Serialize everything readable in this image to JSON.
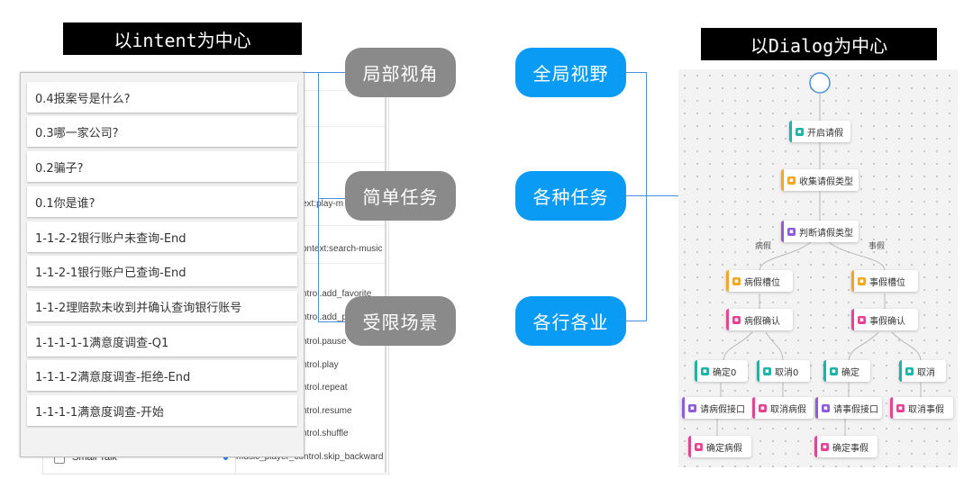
{
  "titles": {
    "left": "以intent为中心",
    "right": "以Dialog为中心"
  },
  "intents": [
    "0.4报案号是什么?",
    "0.3哪一家公司?",
    "0.2骗子?",
    "0.1你是谁?",
    "1-1-2-2银行账户未查询-End",
    "1-1-2-1银行账户已查询-End",
    "1-1-2理赔款未收到并确认查询银行账号",
    "1-1-1-1-1满意度调查-Q1",
    "1-1-1-2满意度调查-拒绝-End",
    "1-1-1-1满意度调查-开始"
  ],
  "background_panel": {
    "right_items": [
      "ext:play-m",
      "ontext:search-music",
      "ntrol.add_favorite",
      "ntrol.add_p",
      "ntrol.pause",
      "ntrol.play",
      "ntrol.repeat",
      "ntrol.resume",
      "ntrol.shuffle"
    ],
    "small_talk": "Small Talk",
    "bottom_item": "music_player_control.skip_backward"
  },
  "bubbles_gray": [
    "局部视角",
    "简单任务",
    "受限场景"
  ],
  "bubbles_blue": [
    "全局视野",
    "各种任务",
    "各行各业"
  ],
  "flow": {
    "nodes": {
      "start": "开启请假",
      "collect": "收集请假类型",
      "judge": "判断请假类型",
      "sick_slot": "病假槽位",
      "personal_slot": "事假槽位",
      "sick_confirm": "病假确认",
      "personal_confirm": "事假确认",
      "ok0": "确定0",
      "cancel0": "取消0",
      "ok": "确定",
      "cancel": "取消",
      "sick_api": "请病假接口",
      "cancel_sick": "取消病假",
      "personal_api": "请事假接口",
      "cancel_personal": "取消事假",
      "confirm_sick": "确定病假",
      "confirm_personal": "确定事假"
    },
    "edge_labels": {
      "sick": "病假",
      "personal": "事假"
    },
    "colors": {
      "teal": "#1bb5a8",
      "orange": "#f5a623",
      "purple": "#8e5cd9",
      "pink": "#e84393"
    }
  }
}
